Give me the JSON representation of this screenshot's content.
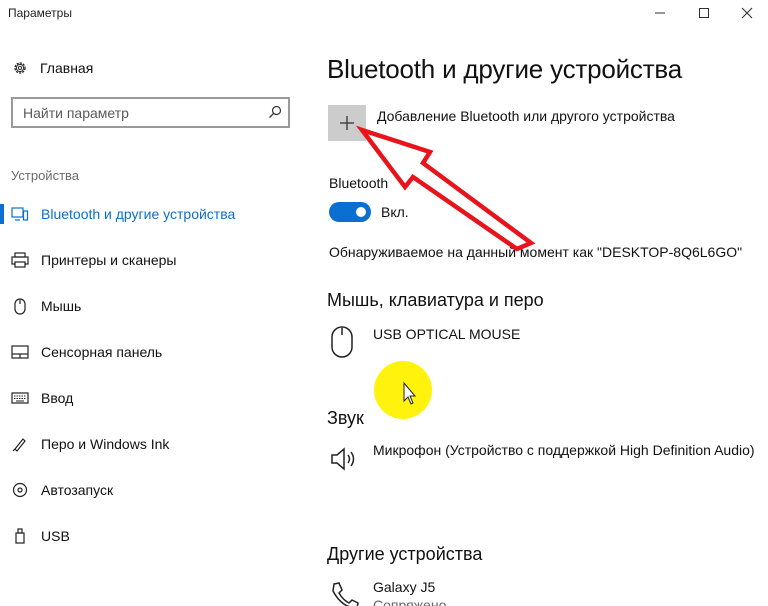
{
  "window": {
    "title": "Параметры",
    "controls": [
      "minimize-icon",
      "maximize-icon",
      "close-icon"
    ]
  },
  "sidebar": {
    "home_label": "Главная",
    "search_placeholder": "Найти параметр",
    "section_label": "Устройства",
    "items": [
      {
        "label": "Bluetooth и другие устройства",
        "icon": "bluetooth-devices-icon",
        "active": true
      },
      {
        "label": "Принтеры и сканеры",
        "icon": "printer-icon",
        "active": false
      },
      {
        "label": "Мышь",
        "icon": "mouse-icon",
        "active": false
      },
      {
        "label": "Сенсорная панель",
        "icon": "touchpad-icon",
        "active": false
      },
      {
        "label": "Ввод",
        "icon": "keyboard-icon",
        "active": false
      },
      {
        "label": "Перо и Windows Ink",
        "icon": "pen-icon",
        "active": false
      },
      {
        "label": "Автозапуск",
        "icon": "autoplay-icon",
        "active": false
      },
      {
        "label": "USB",
        "icon": "usb-icon",
        "active": false
      }
    ]
  },
  "main": {
    "title": "Bluetooth и другие устройства",
    "add_device_label": "Добавление Bluetooth или другого устройства",
    "bluetooth_label": "Bluetooth",
    "bluetooth_state": "Вкл.",
    "discoverable_text": "Обнаруживаемое на данный момент как \"DESKTOP-8Q6L6GO\"",
    "sections": {
      "mouse_keyboard_pen": {
        "heading": "Мышь, клавиатура и перо",
        "devices": [
          {
            "name": "USB OPTICAL MOUSE",
            "icon": "mouse-icon"
          }
        ]
      },
      "audio": {
        "heading": "Звук",
        "devices": [
          {
            "name": "Микрофон (Устройство с поддержкой High Definition Audio)",
            "icon": "speaker-icon"
          }
        ]
      },
      "other": {
        "heading": "Другие устройства",
        "devices": [
          {
            "name": "Galaxy J5",
            "status": "Сопряжено",
            "icon": "phone-icon"
          }
        ]
      }
    }
  },
  "colors": {
    "accent": "#0a6fd0",
    "annotation_arrow": "#e8141c",
    "cursor_highlight": "#fff200"
  }
}
